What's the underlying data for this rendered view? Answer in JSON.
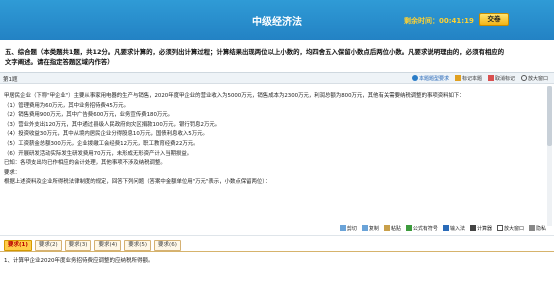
{
  "header": {
    "title": "中级经济法",
    "timer_label": "剩余时间：00:41:19",
    "submit_label": "交卷"
  },
  "question": {
    "text_line1": "五、综合题（本类题共1题，共12分。凡要求计算的，必须列出计算过程；计算结果出现两位以上小数的，均四舍五入保留小数点后两位小数。凡要求说明理由的，必须有相应的",
    "text_line2": "文字阐述。请在指定答题区域内作答）"
  },
  "toolbar": {
    "label": "第1题",
    "tools": [
      "本题题型要求",
      "标记本题",
      "取消标记",
      "放大窗口"
    ]
  },
  "passage": {
    "lines": [
      "甲居民企业（下称\"甲企业\"）主要从事家用电器的生产与销售，2020年度甲企业的营业收入为5000万元，销售成本为2300万元，利润总额为800万元，其他有关需要纳税调整的事项资料如下：",
      "（1）管理费用为60万元，其中业务招待费45万元。",
      "（2）销售费用900万元，其中广告费600万元，业务宣传费180万元。",
      "（3）营业外支出120万元，其中通过县级人民政府向灾区捐款100万元，银行罚息2万元。",
      "（4）投资收益30万元，其中从境内居民企业分得股息10万元，国债利息收入5万元。",
      "（5）工资薪金总额300万元，企业拨缴工会经费12万元，职工教育经费22万元。",
      "（6）开展研发活动实际发生研发费用70万元，未形成无形资产计入当期损益。",
      "已知：各项支出均已作相应的会计处理，其他事项不涉及纳税调整。",
      "要求：",
      "根据上述资料及企业所得税法律制度的规定，回答下列问题（答案中金额单位用\"万元\"表示，小数点保留两位）："
    ]
  },
  "edit_tools": [
    "剪切",
    "复制",
    "粘贴",
    "公式有符号",
    "输入法",
    "计算器",
    "放大窗口",
    "隐私"
  ],
  "subtabs": [
    "要求(1)",
    "要求(2)",
    "要求(3)",
    "要求(4)",
    "要求(5)",
    "要求(6)"
  ],
  "subquestion": {
    "text": "1、计算甲企业2020年度业务招待费应调整的应纳税所得额。"
  },
  "colors": {
    "header_bg": "#2382c4",
    "timer": "#ffd232",
    "submit_bg": "#f3b415",
    "active_tab": "#ffcc4a"
  }
}
